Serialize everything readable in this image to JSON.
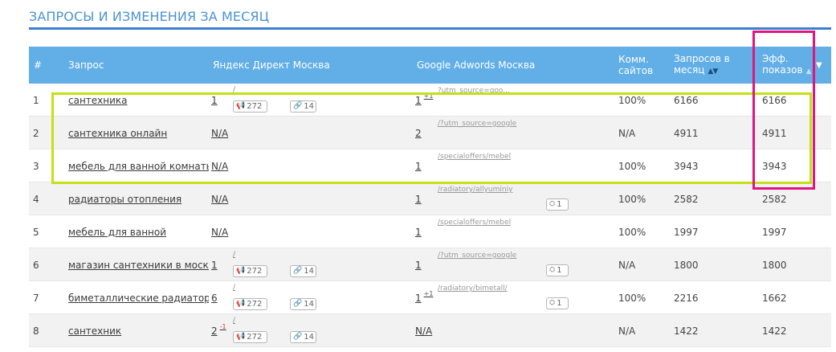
{
  "page_title": "ЗАПРОСЫ И ИЗМЕНЕНИЯ ЗА МЕСЯЦ",
  "header": {
    "num": "#",
    "query": "Запрос",
    "yandex": "Яндекс Директ Москва",
    "google": "Google Adwords Москва",
    "comm_line1": "Комм.",
    "comm_line2": "сайтов",
    "req_line1": "Запросов в",
    "req_line2": "месяц",
    "eff_line1": "Эфф.",
    "eff_line2": "показов"
  },
  "rows": [
    {
      "num": "1",
      "query": "сантехника",
      "yrank": "1",
      "ydelta": "",
      "ylink": "/",
      "ads": "272",
      "links": "14",
      "grank": "1",
      "gdelta": "+1",
      "glink": "?utm_source=goo...",
      "sites": "",
      "comm": "100%",
      "req": "6166",
      "eff": "6166"
    },
    {
      "num": "2",
      "query": "сантехника онлайн",
      "yrank": "N/A",
      "ydelta": "",
      "ylink": "",
      "ads": "",
      "links": "",
      "grank": "2",
      "gdelta": "",
      "glink": "/?utm_source=google",
      "sites": "",
      "comm": "N/A",
      "req": "4911",
      "eff": "4911"
    },
    {
      "num": "3",
      "query": "мебель для ванной комнаты",
      "yrank": "N/A",
      "ydelta": "",
      "ylink": "",
      "ads": "",
      "links": "",
      "grank": "1",
      "gdelta": "",
      "glink": "/specialoffers/mebel",
      "sites": "",
      "comm": "100%",
      "req": "3943",
      "eff": "3943"
    },
    {
      "num": "4",
      "query": "радиаторы отопления",
      "yrank": "N/A",
      "ydelta": "",
      "ylink": "",
      "ads": "",
      "links": "",
      "grank": "1",
      "gdelta": "",
      "glink": "/radiatory/allyuminiy",
      "sites": "1",
      "comm": "100%",
      "req": "2582",
      "eff": "2582"
    },
    {
      "num": "5",
      "query": "мебель для ванной",
      "yrank": "N/A",
      "ydelta": "",
      "ylink": "",
      "ads": "",
      "links": "",
      "grank": "1",
      "gdelta": "",
      "glink": "/specialoffers/mebel",
      "sites": "",
      "comm": "100%",
      "req": "1997",
      "eff": "1997"
    },
    {
      "num": "6",
      "query": "магазин сантехники в москве",
      "yrank": "1",
      "ydelta": "",
      "ylink": "/",
      "ads": "272",
      "links": "14",
      "grank": "1",
      "gdelta": "",
      "glink": "/?utm_source=google",
      "sites": "1",
      "comm": "N/A",
      "req": "1800",
      "eff": "1800"
    },
    {
      "num": "7",
      "query": "биметаллические радиаторы",
      "yrank": "6",
      "ydelta": "",
      "ylink": "/",
      "ads": "272",
      "links": "14",
      "grank": "1",
      "gdelta": "+1",
      "glink": "/radiatory/bimetall/",
      "sites": "1",
      "comm": "100%",
      "req": "2216",
      "eff": "1662"
    },
    {
      "num": "8",
      "query": "сантехник",
      "yrank": "2",
      "ydelta": "-1",
      "ylink": "/",
      "ads": "272",
      "links": "14",
      "grank": "N/A",
      "gdelta": "",
      "glink": "",
      "sites": "",
      "comm": "N/A",
      "req": "1422",
      "eff": "1422"
    }
  ]
}
